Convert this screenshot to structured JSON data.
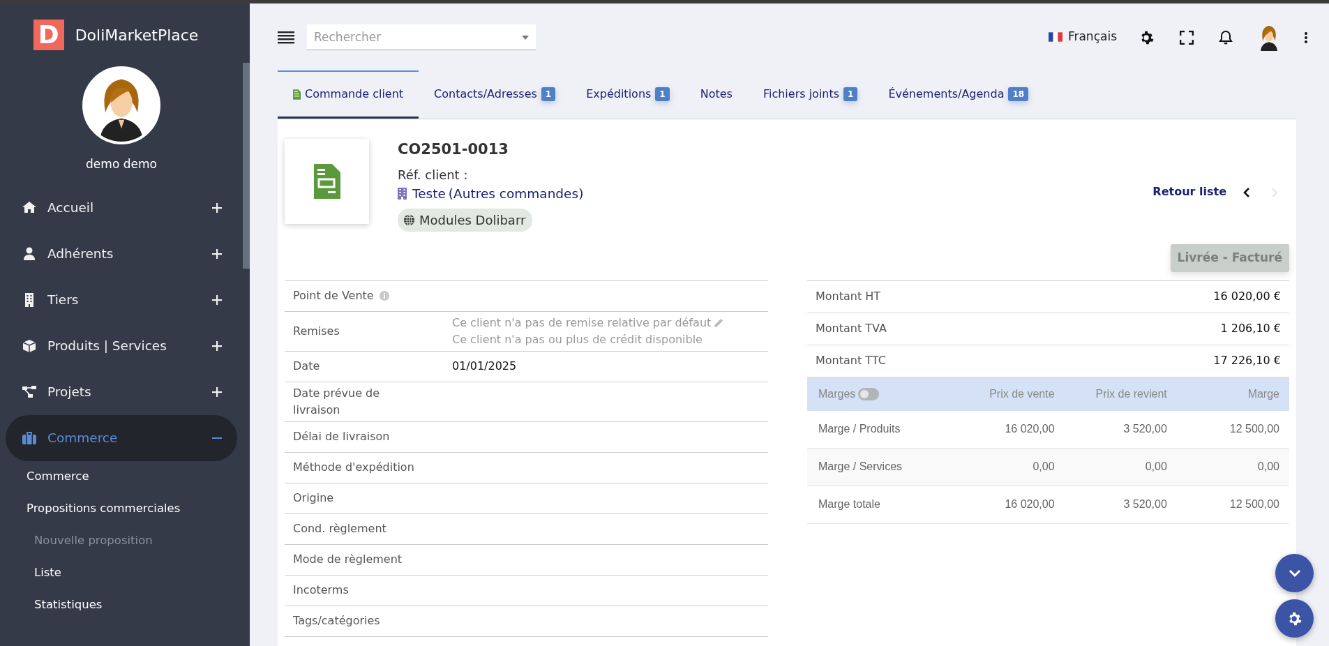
{
  "brand": {
    "logo_letter": "D",
    "name": "DoliMarketPlace"
  },
  "user": {
    "name": "demo demo"
  },
  "sidebar": {
    "items": [
      {
        "label": "Accueil",
        "kind": "home",
        "expanded": false,
        "selected": false
      },
      {
        "label": "Adhérents",
        "kind": "user",
        "expanded": false,
        "selected": false
      },
      {
        "label": "Tiers",
        "kind": "building",
        "expanded": false,
        "selected": false
      },
      {
        "label": "Produits | Services",
        "kind": "cube",
        "expanded": false,
        "selected": false
      },
      {
        "label": "Projets",
        "kind": "tree",
        "expanded": false,
        "selected": false
      },
      {
        "label": "Commerce",
        "kind": "briefcase",
        "expanded": true,
        "selected": true,
        "children": [
          {
            "label": "Commerce",
            "disabled": false
          },
          {
            "label": "Propositions commerciales",
            "disabled": false,
            "children": [
              {
                "label": "Nouvelle proposition",
                "disabled": true
              },
              {
                "label": "Liste",
                "disabled": false
              },
              {
                "label": "Statistiques",
                "disabled": false
              }
            ]
          }
        ]
      }
    ]
  },
  "topbar": {
    "search": {
      "placeholder": "Rechercher"
    },
    "language": "Français"
  },
  "tabs": [
    {
      "label": "Commande client",
      "kind": "icon",
      "selected": true
    },
    {
      "label": "Contacts/Adresses",
      "kind": "plain",
      "badge": "1",
      "selected": false
    },
    {
      "label": "Expéditions",
      "kind": "plain",
      "badge": "1",
      "selected": false
    },
    {
      "label": "Notes",
      "kind": "plain",
      "selected": false
    },
    {
      "label": "Fichiers joints",
      "kind": "plain",
      "badge": "1",
      "selected": false
    },
    {
      "label": "Événements/Agenda",
      "kind": "plain",
      "badge": "18",
      "selected": false
    }
  ],
  "order": {
    "ref": "CO2501-0013",
    "ref_client": "Réf. client :",
    "customer": "Teste",
    "customer_note": "(Autres commandes)",
    "project": "Modules Dolibarr",
    "back_link": "Retour liste",
    "status": "Livrée - Facturé"
  },
  "fields": [
    {
      "label": "Point de Vente",
      "kind": "info"
    },
    {
      "label": "Remises",
      "kind": "notes",
      "notes": [
        "Ce client n'a pas de remise relative par défaut",
        "Ce client n'a pas ou plus de crédit disponible"
      ]
    },
    {
      "label": "Date",
      "kind": "value",
      "value": "01/01/2025"
    },
    {
      "label": "Date prévue de livraison",
      "kind": "plain"
    },
    {
      "label": "Délai de livraison",
      "kind": "plain"
    },
    {
      "label": "Méthode d'expédition",
      "kind": "plain"
    },
    {
      "label": "Origine",
      "kind": "plain"
    },
    {
      "label": "Cond. règlement",
      "kind": "plain"
    },
    {
      "label": "Mode de règlement",
      "kind": "plain"
    },
    {
      "label": "Incoterms",
      "kind": "plain"
    },
    {
      "label": "Tags/catégories",
      "kind": "plain"
    }
  ],
  "totals": [
    {
      "label": "Montant HT",
      "amount": "16 020,00 €"
    },
    {
      "label": "Montant TVA",
      "amount": "1 206,10 €"
    },
    {
      "label": "Montant TTC",
      "amount": "17 226,10 €"
    }
  ],
  "margins": {
    "label": "Marges",
    "on": false,
    "columns": [
      "Prix de vente",
      "Prix de revient",
      "Marge"
    ],
    "rows": [
      {
        "label": "Marge / Produits",
        "values": [
          "16 020,00",
          "3 520,00",
          "12 500,00"
        ]
      },
      {
        "label": "Marge / Services",
        "values": [
          "0,00",
          "0,00",
          "0,00"
        ]
      },
      {
        "label": "Marge totale",
        "values": [
          "16 020,00",
          "3 520,00",
          "12 500,00"
        ]
      }
    ]
  }
}
